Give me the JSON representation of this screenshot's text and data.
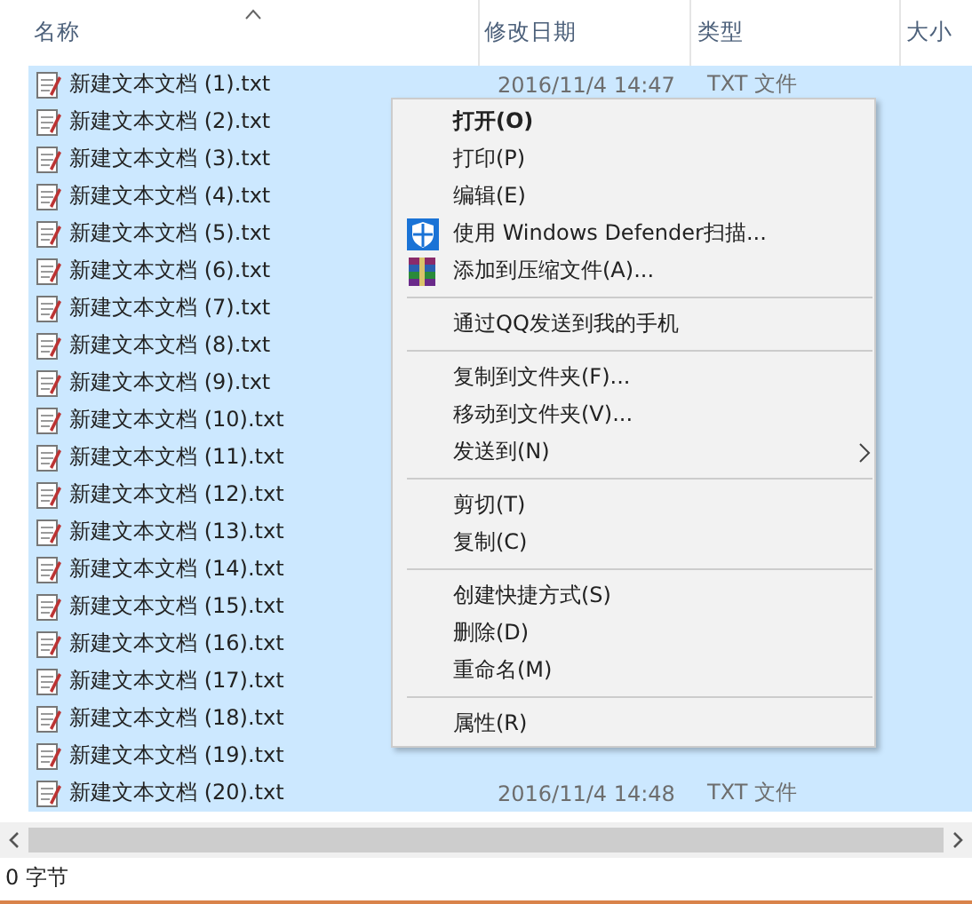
{
  "columns": [
    {
      "label": "名称",
      "sorted": true
    },
    {
      "label": "修改日期",
      "sorted": false
    },
    {
      "label": "类型",
      "sorted": false
    },
    {
      "label": "大小",
      "sorted": false
    }
  ],
  "rows": [
    {
      "name": "新建文本文档 (1).txt",
      "date": "2016/11/4 14:47",
      "type": "TXT 文件",
      "selected": true
    },
    {
      "name": "新建文本文档 (2).txt",
      "selected": true
    },
    {
      "name": "新建文本文档 (3).txt",
      "selected": true
    },
    {
      "name": "新建文本文档 (4).txt",
      "selected": true
    },
    {
      "name": "新建文本文档 (5).txt",
      "selected": true
    },
    {
      "name": "新建文本文档 (6).txt",
      "selected": true
    },
    {
      "name": "新建文本文档 (7).txt",
      "selected": true
    },
    {
      "name": "新建文本文档 (8).txt",
      "selected": true
    },
    {
      "name": "新建文本文档 (9).txt",
      "selected": true
    },
    {
      "name": "新建文本文档 (10).txt",
      "selected": true
    },
    {
      "name": "新建文本文档 (11).txt",
      "selected": true
    },
    {
      "name": "新建文本文档 (12).txt",
      "selected": true
    },
    {
      "name": "新建文本文档 (13).txt",
      "selected": true
    },
    {
      "name": "新建文本文档 (14).txt",
      "selected": true
    },
    {
      "name": "新建文本文档 (15).txt",
      "selected": true
    },
    {
      "name": "新建文本文档 (16).txt",
      "selected": true
    },
    {
      "name": "新建文本文档 (17).txt",
      "selected": true
    },
    {
      "name": "新建文本文档 (18).txt",
      "selected": true
    },
    {
      "name": "新建文本文档 (19).txt",
      "selected": true
    },
    {
      "name": "新建文本文档 (20).txt",
      "date": "2016/11/4 14:48",
      "type": "TXT 文件",
      "selected": true
    }
  ],
  "context_menu": [
    {
      "kind": "item",
      "label": "打开(O)",
      "bold": true
    },
    {
      "kind": "item",
      "label": "打印(P)"
    },
    {
      "kind": "item",
      "label": "编辑(E)"
    },
    {
      "kind": "scan",
      "label": "使用 Windows Defender扫描..."
    },
    {
      "kind": "compress",
      "label": "添加到压缩文件(A)..."
    },
    {
      "kind": "separator"
    },
    {
      "kind": "item",
      "label": "通过QQ发送到我的手机"
    },
    {
      "kind": "separator"
    },
    {
      "kind": "item",
      "label": "复制到文件夹(F)..."
    },
    {
      "kind": "item",
      "label": "移动到文件夹(V)..."
    },
    {
      "kind": "item",
      "label": "发送到(N)",
      "submenu": true
    },
    {
      "kind": "separator"
    },
    {
      "kind": "item",
      "label": "剪切(T)"
    },
    {
      "kind": "item",
      "label": "复制(C)"
    },
    {
      "kind": "separator"
    },
    {
      "kind": "item",
      "label": "创建快捷方式(S)"
    },
    {
      "kind": "item",
      "label": "删除(D)"
    },
    {
      "kind": "item",
      "label": "重命名(M)"
    },
    {
      "kind": "separator"
    },
    {
      "kind": "item",
      "label": "属性(R)"
    }
  ],
  "status_bar": "0 字节"
}
